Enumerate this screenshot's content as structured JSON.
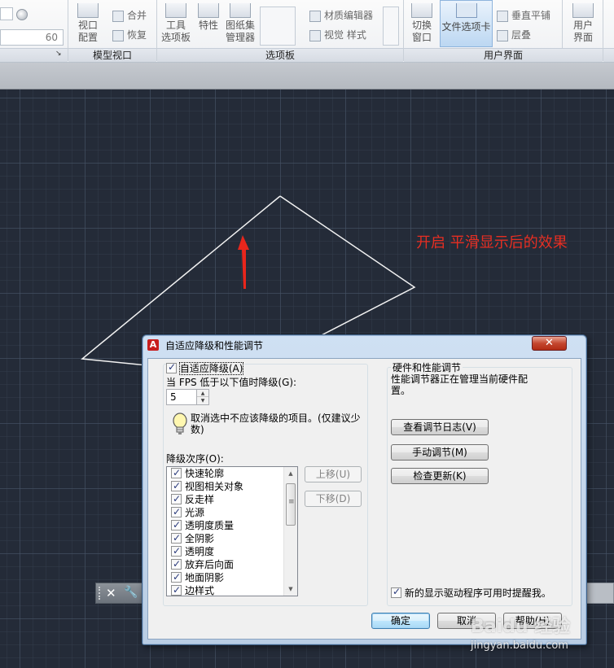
{
  "ribbon": {
    "field_value": "60",
    "viewport_config_label": "视口\n配置",
    "merge_label": "合并",
    "restore_label": "恢复",
    "tool_palette_label": "工具\n选项板",
    "properties_label": "特性",
    "sheet_set_label": "图纸集\n管理器",
    "material_editor_label": "材质编辑器",
    "visual_style_label": "视觉 样式",
    "switch_window_label": "切换\n窗口",
    "file_tabs_label": "文件选项卡",
    "tile_vertical_label": "垂直平铺",
    "cascade_label": "层叠",
    "user_interface_label": "用户\n界面",
    "panels": [
      "模型视口",
      "选项板",
      "用户界面"
    ]
  },
  "annotation": "开启 平滑显示后的效果",
  "dialog": {
    "title": "自适应降级和性能调节",
    "close_glyph": "✕",
    "adaptive": {
      "checkbox_label": "自适应降级(A)",
      "checked": true,
      "fps_label": "当 FPS 低于以下值时降级(G):",
      "fps_value": "5",
      "tip": "取消选中不应该降级的项目。(仅建议少数)",
      "order_label": "降级次序(O):",
      "items": [
        {
          "label": "快速轮廓",
          "checked": true
        },
        {
          "label": "视图相关对象",
          "checked": true
        },
        {
          "label": "反走样",
          "checked": true
        },
        {
          "label": "光源",
          "checked": true
        },
        {
          "label": "透明度质量",
          "checked": true
        },
        {
          "label": "全阴影",
          "checked": true
        },
        {
          "label": "透明度",
          "checked": true
        },
        {
          "label": "放弃后向面",
          "checked": true
        },
        {
          "label": "地面阴影",
          "checked": true
        },
        {
          "label": "边样式",
          "checked": true
        }
      ],
      "move_up_label": "上移(U)",
      "move_down_label": "下移(D)"
    },
    "hardware": {
      "group_title": "硬件和性能调节",
      "description": "性能调节器正在管理当前硬件配置。",
      "view_log_label": "查看调节日志(V)",
      "manual_tune_label": "手动调节(M)",
      "check_updates_label": "检查更新(K)",
      "remind_label": "新的显示驱动程序可用时提醒我。",
      "remind_checked": true
    },
    "ok_label": "确定",
    "cancel_label": "取消",
    "help_label": "帮助(H)"
  },
  "watermark": {
    "brand": "Baidu 经验",
    "url": "jingyan.baidu.com"
  },
  "colors": {
    "canvas_bg": "#242b38",
    "annotation_red": "#e62e22",
    "arrow_red": "#e8261c",
    "dialog_frame": "#b9cde4"
  }
}
